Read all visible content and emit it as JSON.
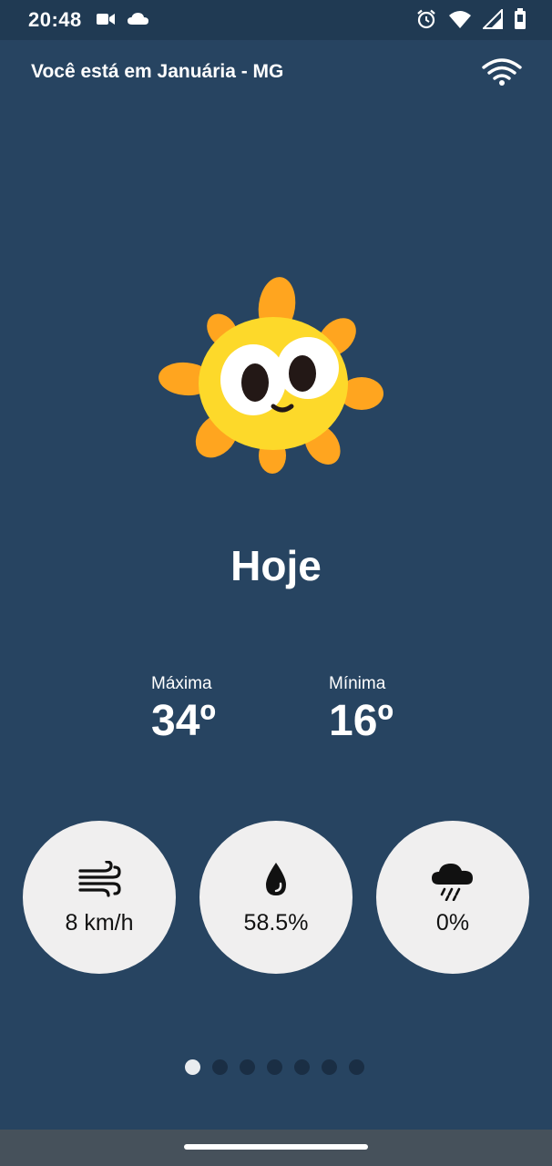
{
  "status_bar": {
    "time": "20:48",
    "left_icons": [
      "video-camera-icon",
      "cloud-icon"
    ],
    "right_icons": [
      "alarm-icon",
      "wifi-signal-icon",
      "cellular-signal-icon",
      "battery-icon"
    ]
  },
  "header": {
    "location": "Você está em Januária - MG",
    "connectivity_icon": "wifi-icon"
  },
  "weather": {
    "illustration": "sun-mascot",
    "day": "Hoje",
    "max_label": "Máxima",
    "max_value": "34º",
    "min_label": "Mínima",
    "min_value": "16º"
  },
  "metrics": [
    {
      "icon": "wind-icon",
      "value": "8 km/h"
    },
    {
      "icon": "water-drop-icon",
      "value": "58.5%"
    },
    {
      "icon": "rain-cloud-icon",
      "value": "0%"
    }
  ],
  "pager": {
    "total": 7,
    "active_index": 0
  },
  "colors": {
    "background": "#274461",
    "status_bar": "#203a53",
    "metric_circle": "#f0efef",
    "dot_active": "#e9ecef",
    "dot_inactive": "#1a2e44",
    "nav_bar": "#46515b"
  }
}
